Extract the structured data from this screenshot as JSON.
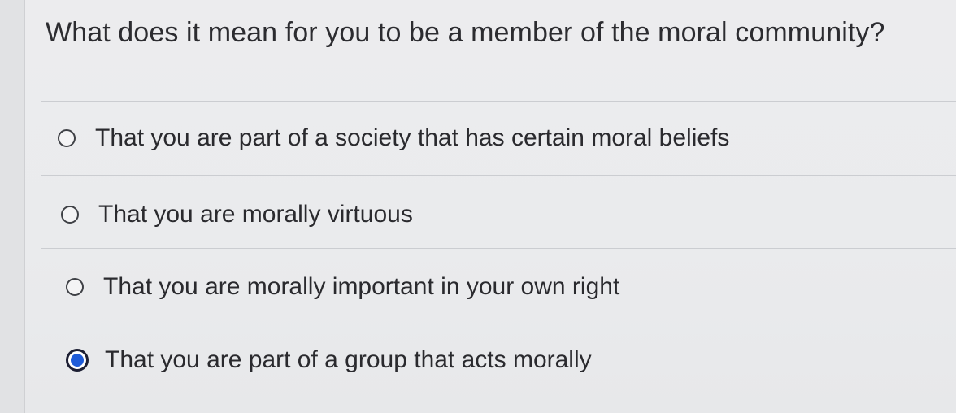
{
  "question": {
    "text": "What does it mean for you to be a member of the moral community?"
  },
  "options": [
    {
      "label": "That you are part of a society that has certain moral beliefs",
      "selected": false
    },
    {
      "label": "That you are morally virtuous",
      "selected": false
    },
    {
      "label": "That you are morally important in your own right",
      "selected": false
    },
    {
      "label": "That you are part of a group that acts morally",
      "selected": true
    }
  ],
  "colors": {
    "selected_radio": "#1e5bd8",
    "background": "#e9eaec",
    "text": "#2b2b2e"
  }
}
